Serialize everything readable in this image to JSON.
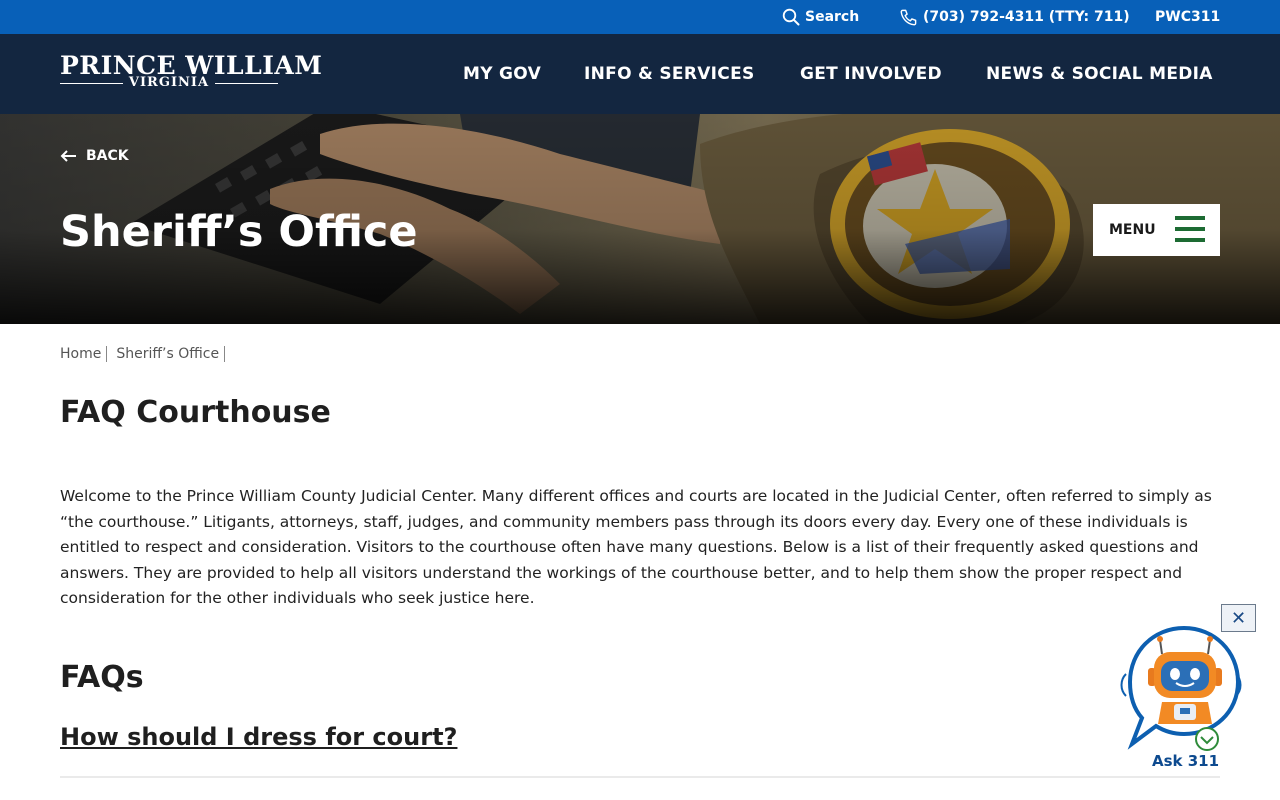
{
  "utility_bar": {
    "search_label": "Search",
    "phone_label": "(703) 792-4311 (TTY: 711)",
    "pwc311_label": "PWC311"
  },
  "header": {
    "logo_line1": "PRINCE WILLIAM",
    "logo_line2": "VIRGINIA",
    "nav": [
      {
        "label": "MY GOV"
      },
      {
        "label": "INFO & SERVICES"
      },
      {
        "label": "GET INVOLVED"
      },
      {
        "label": "NEWS & SOCIAL MEDIA"
      }
    ]
  },
  "hero": {
    "back_label": "BACK",
    "title": "Sheriff’s Office",
    "menu_label": "MENU"
  },
  "breadcrumb": [
    "Home",
    "Sheriff’s Office"
  ],
  "main": {
    "title": "FAQ Courthouse",
    "intro": "Welcome to the Prince William County Judicial Center.  Many different offices and courts are located in the Judicial Center, often referred to simply as “the courthouse.”  Litigants, attorneys, staff, judges, and community members pass through its doors every day.  Every one of these individuals is entitled to respect and consideration.  Visitors to the courthouse often have many questions.  Below is a list of their frequently asked questions and answers.  They are provided to help all visitors understand the workings of the courthouse better, and to help them show the proper respect and consideration for the other individuals who seek justice here.",
    "faq_heading": "FAQs",
    "faqs": [
      {
        "question": "How should I dress for court?"
      }
    ]
  },
  "chat": {
    "close_label": "✕",
    "label": "Ask 311"
  },
  "colors": {
    "utility_bar": "#0860b8",
    "header": "#132640",
    "menu_bars": "#1d6b33",
    "chat_accent": "#0d4a8f"
  }
}
